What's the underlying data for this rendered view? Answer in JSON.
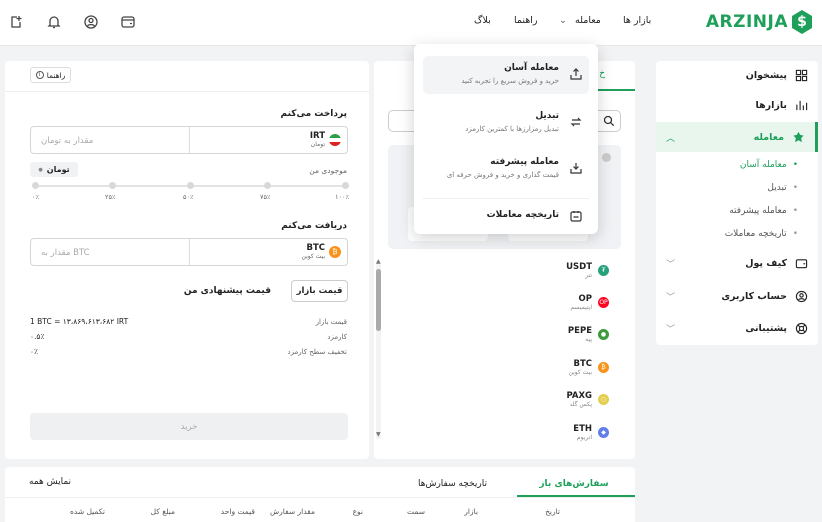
{
  "brand": {
    "name": "ARZINJA",
    "color": "#1fa05a"
  },
  "topnav": {
    "markets": "بازار ها",
    "trade": "معامله",
    "guide": "راهنما",
    "blog": "بلاگ"
  },
  "top_icons": [
    "wallet-icon",
    "user-icon",
    "bell-icon",
    "export-icon"
  ],
  "sidebar": {
    "items": [
      {
        "label": "پیشخوان",
        "icon": "dashboard-icon"
      },
      {
        "label": "بازارها",
        "icon": "chart-icon"
      },
      {
        "label": "معامله",
        "icon": "trade-icon"
      },
      {
        "label": "کیف پول",
        "icon": "wallet-icon"
      },
      {
        "label": "حساب کاربری",
        "icon": "user-icon"
      },
      {
        "label": "پشتیبانی",
        "icon": "support-icon"
      }
    ],
    "sub_items": [
      "معامله آسان",
      "تبدیل",
      "معامله پیشرفته",
      "تاریخچه معاملات"
    ]
  },
  "dropdown": {
    "items": [
      {
        "title": "معامله آسان",
        "desc": "خرید و فروش سریع را تجربه کنید"
      },
      {
        "title": "تبدیل",
        "desc": "تبدیل رمزارزها با کمترین کارمزد"
      },
      {
        "title": "معامله پیشرفته",
        "desc": "قیمت گذاری و خرید و فروش حرفه ای"
      },
      {
        "title": "تاریخچه معاملات",
        "desc": ""
      }
    ]
  },
  "market": {
    "tab_partial": "خ",
    "coins": [
      {
        "symbol": "USDT",
        "name": "تتر",
        "color": "#26a17b"
      },
      {
        "symbol": "OP",
        "name": "اپتیمیسم",
        "color": "#ff0420"
      },
      {
        "symbol": "PEPE",
        "name": "پپه",
        "color": "#3d9a3d"
      },
      {
        "symbol": "BTC",
        "name": "بیت کوین",
        "color": "#f7931a"
      },
      {
        "symbol": "PAXG",
        "name": "پکس گلد",
        "color": "#e4ce4d"
      },
      {
        "symbol": "ETH",
        "name": "اتریوم",
        "color": "#627eea"
      }
    ]
  },
  "trade": {
    "guide_button": "راهنما",
    "pay_label": "پرداخت می‌کنم",
    "pay_currency": {
      "symbol": "IRT",
      "name": "تومان"
    },
    "pay_placeholder": "مقدار به تومان",
    "balance_label": "موجودی من",
    "balance_unit": "تومان",
    "slider_ticks": [
      "۰٪",
      "۲۵٪",
      "۵۰٪",
      "۷۵٪",
      "۱۰۰٪"
    ],
    "receive_label": "دریافت می‌کنم",
    "receive_currency": {
      "symbol": "BTC",
      "name": "بیت کوین"
    },
    "receive_placeholder": "مقدار به BTC",
    "market_price_button": "قیمت بازار",
    "offer_price_label": "قیمت پیشنهادی من",
    "rows": [
      {
        "label": "قیمت بازار",
        "value": "1 BTC = ۱۳،۸۶۹،۶۱۳،۶۸۲ IRT"
      },
      {
        "label": "کارمزد",
        "value": "۰.۵٪"
      },
      {
        "label": "تخفیف سطح کارمزد",
        "value": "۰٪"
      }
    ],
    "buy_button": "خرید"
  },
  "orders": {
    "tabs": [
      "سفارش‌های باز",
      "تاریخچه سفارش‌ها"
    ],
    "show_all": "نمایش همه",
    "columns": [
      "تاریخ",
      "بازار",
      "سمت",
      "نوع",
      "مقدار سفارش",
      "قیمت واحد",
      "مبلغ کل",
      "تکمیل شده"
    ]
  }
}
